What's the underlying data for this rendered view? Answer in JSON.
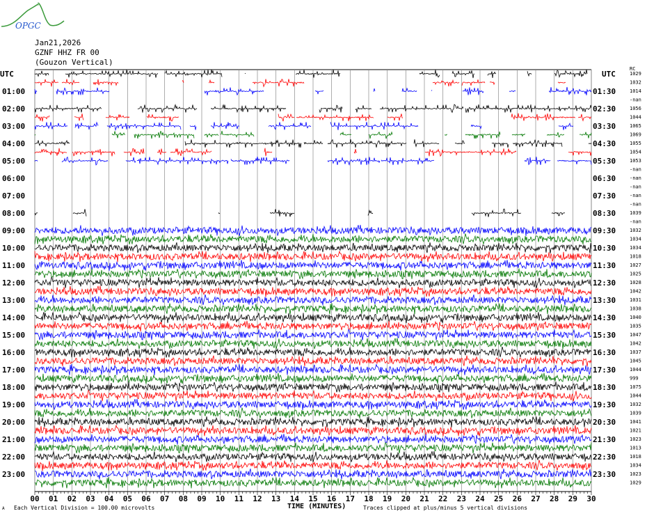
{
  "header": {
    "date": "Jan21,2026",
    "station": "GZNF HHZ FR 00",
    "description": "(Gouzon Vertical)",
    "logo_text": "OPGC"
  },
  "footer": {
    "scale_note": "Each Vertical Division =  100.00 microvolts",
    "xlabel": "TIME (MINUTES)",
    "clip_note": "Traces clipped at plus/minus 5 vertical divisions",
    "corner_mark": "A"
  },
  "colors": {
    "trace_cycle": [
      "#000000",
      "#ff0000",
      "#0000ff",
      "#007700"
    ],
    "grid": "#888888",
    "logo_green": "#3a9a3a",
    "logo_blue": "#2255cc"
  },
  "chart_data": {
    "type": "line",
    "subtype": "helicorder",
    "title": "GZNF HHZ FR 00 (Gouzon Vertical) Jan21,2026",
    "xlabel": "TIME (MINUTES)",
    "xlim": [
      0,
      30
    ],
    "x_ticks": [
      "00",
      "01",
      "02",
      "03",
      "04",
      "05",
      "06",
      "07",
      "08",
      "09",
      "10",
      "11",
      "12",
      "13",
      "14",
      "15",
      "16",
      "17",
      "18",
      "19",
      "20",
      "21",
      "22",
      "23",
      "24",
      "25",
      "26",
      "27",
      "28",
      "29",
      "30"
    ],
    "left_header": "UTC",
    "right_header": "UTC",
    "right_col_header": "RC",
    "left_labels": [
      "UTC",
      "",
      "01:00",
      "",
      "02:00",
      "",
      "03:00",
      "",
      "04:00",
      "",
      "05:00",
      "",
      "06:00",
      "",
      "07:00",
      "",
      "08:00",
      "",
      "09:00",
      "",
      "10:00",
      "",
      "11:00",
      "",
      "12:00",
      "",
      "13:00",
      "",
      "14:00",
      "",
      "15:00",
      "",
      "16:00",
      "",
      "17:00",
      "",
      "18:00",
      "",
      "19:00",
      "",
      "20:00",
      "",
      "21:00",
      "",
      "22:00",
      "",
      "23:00",
      ""
    ],
    "right_labels": [
      "UTC",
      "",
      "01:30",
      "",
      "02:30",
      "",
      "03:30",
      "",
      "04:30",
      "",
      "05:30",
      "",
      "06:30",
      "",
      "07:30",
      "",
      "08:30",
      "",
      "09:30",
      "",
      "10:30",
      "",
      "11:30",
      "",
      "12:30",
      "",
      "13:30",
      "",
      "14:30",
      "",
      "15:30",
      "",
      "16:30",
      "",
      "17:30",
      "",
      "18:30",
      "",
      "19:30",
      "",
      "20:30",
      "",
      "21:30",
      "",
      "22:30",
      "",
      "23:30",
      ""
    ],
    "row_values": [
      "1029",
      "1032",
      "1014",
      "-nan",
      "1056",
      "1044",
      "1065",
      "1069",
      "1055",
      "1054",
      "1053",
      "-nan",
      "-nan",
      "-nan",
      "-nan",
      "-nan",
      "1039",
      "-nan",
      "1032",
      "1034",
      "1034",
      "1018",
      "1027",
      "1025",
      "1028",
      "1042",
      "1031",
      "1038",
      "1040",
      "1035",
      "1047",
      "1042",
      "1037",
      "1045",
      "1044",
      "999",
      "1075",
      "1044",
      "1032",
      "1039",
      "1041",
      "1021",
      "1023",
      "1013",
      "1018",
      "1034",
      "1023",
      "1029"
    ],
    "row_modes": [
      "i",
      "i",
      "i",
      "n",
      "i",
      "i",
      "i",
      "i",
      "i",
      "i",
      "i",
      "n",
      "n",
      "n",
      "n",
      "n",
      "i",
      "n",
      "c",
      "c",
      "c",
      "c",
      "c",
      "c",
      "c",
      "c",
      "c",
      "c",
      "c",
      "c",
      "c",
      "c",
      "c",
      "c",
      "c",
      "c",
      "c",
      "c",
      "c",
      "c",
      "c",
      "c",
      "c",
      "c",
      "c",
      "c",
      "c",
      "c"
    ],
    "units": "microvolts",
    "vertical_division_uV": 100.0,
    "clip_divisions": 5
  }
}
